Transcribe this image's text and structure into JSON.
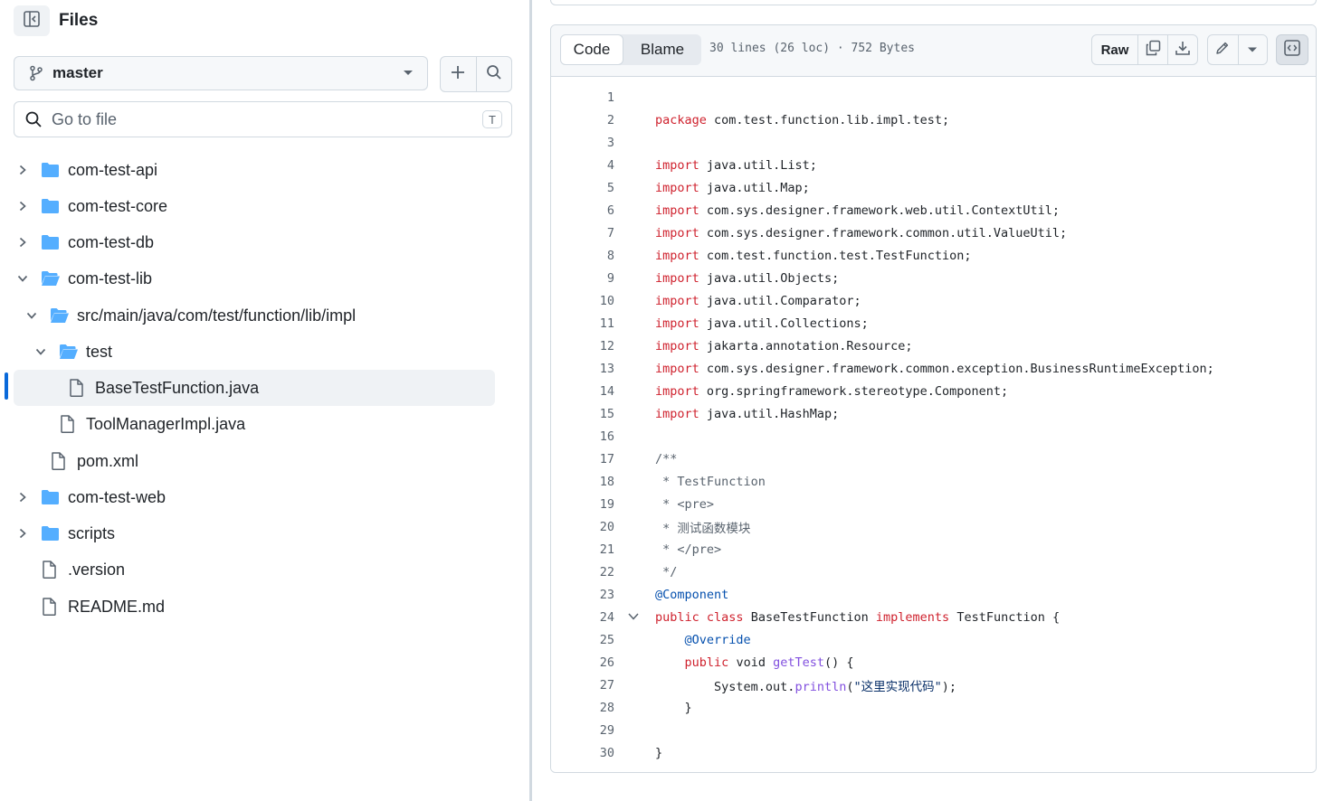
{
  "sidebar": {
    "title": "Files",
    "branch": "master",
    "search_placeholder": "Go to file",
    "search_shortcut": "T",
    "tree": [
      {
        "label": "com-test-api",
        "kind": "folder",
        "depth": 0,
        "expanded": false
      },
      {
        "label": "com-test-core",
        "kind": "folder",
        "depth": 0,
        "expanded": false
      },
      {
        "label": "com-test-db",
        "kind": "folder",
        "depth": 0,
        "expanded": false
      },
      {
        "label": "com-test-lib",
        "kind": "folder",
        "depth": 0,
        "expanded": true
      },
      {
        "label": "src/main/java/com/test/function/lib/impl",
        "kind": "folder",
        "depth": 1,
        "expanded": true
      },
      {
        "label": "test",
        "kind": "folder",
        "depth": 2,
        "expanded": true
      },
      {
        "label": "BaseTestFunction.java",
        "kind": "file",
        "depth": 3,
        "selected": true
      },
      {
        "label": "ToolManagerImpl.java",
        "kind": "file",
        "depth": 2
      },
      {
        "label": "pom.xml",
        "kind": "file",
        "depth": 1
      },
      {
        "label": "com-test-web",
        "kind": "folder",
        "depth": 0,
        "expanded": false
      },
      {
        "label": "scripts",
        "kind": "folder",
        "depth": 0,
        "expanded": false
      },
      {
        "label": ".version",
        "kind": "file",
        "depth": 0
      },
      {
        "label": "README.md",
        "kind": "file",
        "depth": 0
      }
    ]
  },
  "viewer": {
    "tabs": {
      "code": "Code",
      "blame": "Blame"
    },
    "meta": "30 lines (26 loc) · 752 Bytes",
    "raw_label": "Raw"
  },
  "code": {
    "lines": [
      [],
      [
        [
          "kw",
          "package"
        ],
        [
          "",
          "com.test.function.lib.impl.test;"
        ]
      ],
      [],
      [
        [
          "kw",
          "import"
        ],
        [
          "",
          "java.util.List;"
        ]
      ],
      [
        [
          "kw",
          "import"
        ],
        [
          "",
          "java.util.Map;"
        ]
      ],
      [
        [
          "kw",
          "import"
        ],
        [
          "",
          "com.sys.designer.framework.web.util.ContextUtil;"
        ]
      ],
      [
        [
          "kw",
          "import"
        ],
        [
          "",
          "com.sys.designer.framework.common.util.ValueUtil;"
        ]
      ],
      [
        [
          "kw",
          "import"
        ],
        [
          "",
          "com.test.function.test.TestFunction;"
        ]
      ],
      [
        [
          "kw",
          "import"
        ],
        [
          "",
          "java.util.Objects;"
        ]
      ],
      [
        [
          "kw",
          "import"
        ],
        [
          "",
          "java.util.Comparator;"
        ]
      ],
      [
        [
          "kw",
          "import"
        ],
        [
          "",
          "java.util.Collections;"
        ]
      ],
      [
        [
          "kw",
          "import"
        ],
        [
          "",
          "jakarta.annotation.Resource;"
        ]
      ],
      [
        [
          "kw",
          "import"
        ],
        [
          "",
          "com.sys.designer.framework.common.exception.BusinessRuntimeException;"
        ]
      ],
      [
        [
          "kw",
          "import"
        ],
        [
          "",
          "org.springframework.stereotype.Component;"
        ]
      ],
      [
        [
          "kw",
          "import"
        ],
        [
          "",
          "java.util.HashMap;"
        ]
      ],
      [],
      [
        [
          "cm",
          "/**"
        ]
      ],
      [
        [
          "cm",
          " * TestFunction"
        ]
      ],
      [
        [
          "cm",
          " * <pre>"
        ]
      ],
      [
        [
          "cm",
          " * 测试函数模块"
        ]
      ],
      [
        [
          "cm",
          " * </pre>"
        ]
      ],
      [
        [
          "cm",
          " */"
        ]
      ],
      [
        [
          "an",
          "@Component"
        ]
      ],
      [
        [
          "kw",
          "public"
        ],
        [
          "kw",
          "class"
        ],
        [
          "",
          "BaseTestFunction"
        ],
        [
          "kw",
          "implements"
        ],
        [
          "",
          "TestFunction {"
        ]
      ],
      [
        [
          "ws",
          "    "
        ],
        [
          "an",
          "@Override"
        ]
      ],
      [
        [
          "ws",
          "    "
        ],
        [
          "kw",
          "public"
        ],
        [
          "",
          "void"
        ],
        [
          "fn",
          "getTest"
        ],
        [
          "",
          "() {"
        ]
      ],
      [
        [
          "ws",
          "        "
        ],
        [
          "",
          "System.out."
        ],
        [
          "fn",
          "println"
        ],
        [
          "",
          "("
        ],
        [
          "st",
          "\"这里实现代码\""
        ],
        [
          "",
          ");"
        ]
      ],
      [
        [
          "ws",
          "    "
        ],
        [
          "",
          "}"
        ]
      ],
      [],
      [
        [
          "",
          "}"
        ]
      ]
    ]
  }
}
